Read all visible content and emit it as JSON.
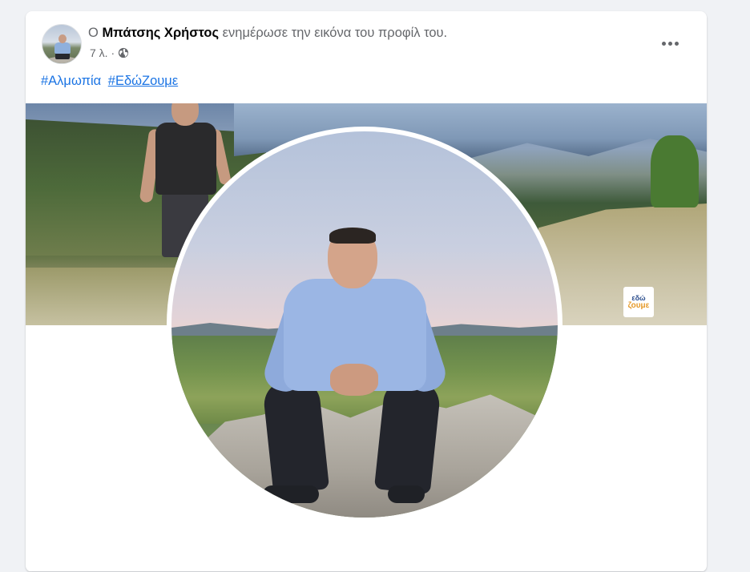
{
  "post": {
    "prefix": "Ο",
    "author": "Μπάτσης Χρήστος",
    "action": "ενημέρωσε την εικόνα του προφίλ του.",
    "time": "7 λ. ·",
    "audience_icon": "globe-icon",
    "more_icon": "more-options-icon"
  },
  "hashtags": [
    {
      "text": "#Αλμωπία",
      "underlined": false
    },
    {
      "text": "#ΕδώΖουμε",
      "underlined": true
    }
  ],
  "cover": {
    "logo_line1": "εδώ",
    "logo_line2": "ζουμε"
  },
  "colors": {
    "link": "#1b74e4",
    "background": "#f0f2f5",
    "card": "#ffffff",
    "secondary_text": "#65676b"
  }
}
